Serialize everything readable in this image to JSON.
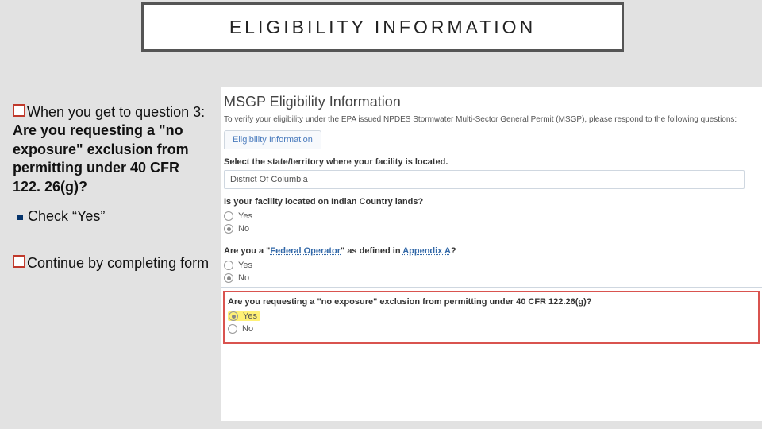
{
  "title": "ELIGIBILITY INFORMATION",
  "left": {
    "p1_pre": "When you get to question 3: ",
    "p1_bold": "Are you requesting a \"no exposure\" exclusion from permitting under 40 CFR 122. 26(g)?",
    "p2": "Check “Yes”",
    "p3": "Continue by completing form"
  },
  "panel": {
    "heading": "MSGP Eligibility Information",
    "intro": "To verify your eligibility under the EPA issued NPDES Stormwater Multi-Sector General Permit (MSGP), please respond to the following questions:",
    "tab": "Eligibility Information",
    "q1": "Select the state/territory where your facility is located.",
    "q1_value": "District Of Columbia",
    "q2": "Is your facility located on Indian Country lands?",
    "yes": "Yes",
    "no": "No",
    "q3_pre": "Are you a \"",
    "q3_link1": "Federal Operator",
    "q3_mid": "\" as defined in ",
    "q3_link2": "Appendix A",
    "q3_post": "?",
    "q4": "Are you requesting a \"no exposure\" exclusion from permitting under 40 CFR 122.26(g)?"
  }
}
